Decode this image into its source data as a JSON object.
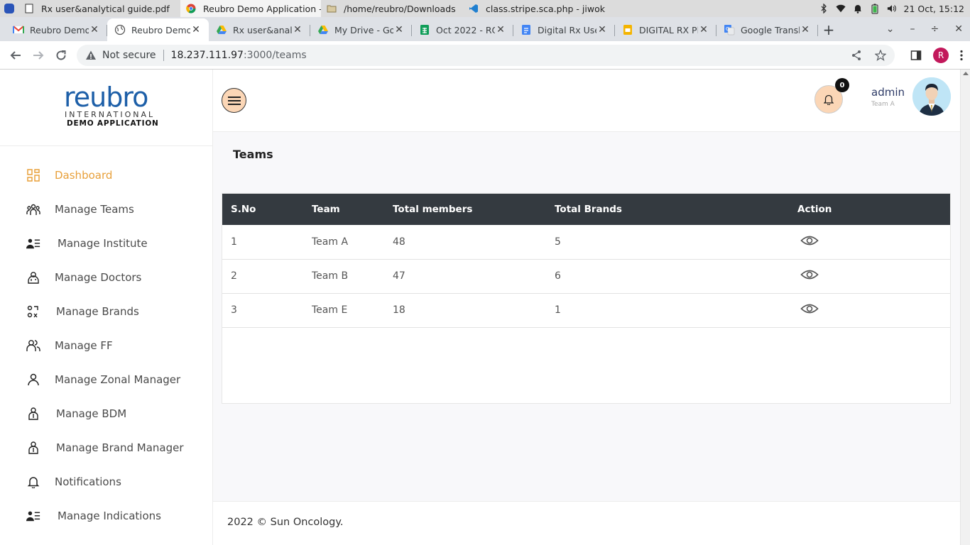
{
  "os": {
    "tasks": [
      {
        "label": "Rx user&analytical guide.pdf",
        "icon": "document-icon",
        "active": false
      },
      {
        "label": "Reubro Demo Application - ...",
        "icon": "chrome-icon",
        "active": true
      },
      {
        "label": "/home/reubro/Downloads",
        "icon": "folder-icon",
        "active": false
      },
      {
        "label": "class.stripe.sca.php - jiwok - ...",
        "icon": "vscode-icon",
        "active": false
      }
    ],
    "clock": "21 Oct, 15:12"
  },
  "browser": {
    "tabs": [
      {
        "label": "Reubro Demo",
        "icon": "gmail-icon",
        "active": false
      },
      {
        "label": "Reubro Demo",
        "icon": "globe-icon",
        "active": true
      },
      {
        "label": "Rx user&analy",
        "icon": "drive-icon",
        "active": false
      },
      {
        "label": "My Drive - Go",
        "icon": "drive-icon",
        "active": false
      },
      {
        "label": "Oct 2022 - RO",
        "icon": "sheets-icon",
        "active": false
      },
      {
        "label": "Digital Rx Use",
        "icon": "docs-icon",
        "active": false
      },
      {
        "label": "DIGITAL RX Pl",
        "icon": "slides-icon",
        "active": false
      },
      {
        "label": "Google Transl",
        "icon": "translate-icon",
        "active": false
      }
    ],
    "security_label": "Not secure",
    "url_host": "18.237.111.97",
    "url_path": ":3000/teams",
    "profile_initial": "R"
  },
  "sidebar": {
    "logo_main_1": "reu",
    "logo_main_2": "bro",
    "logo_sub": "INTERNATIONAL",
    "logo_demo": "DEMO APPLICATION",
    "items": [
      {
        "label": "Dashboard",
        "icon": "dashboard-icon"
      },
      {
        "label": "Manage Teams",
        "icon": "team-icon"
      },
      {
        "label": "Manage Institute",
        "icon": "institute-list-icon"
      },
      {
        "label": "Manage Doctors",
        "icon": "doctor-icon"
      },
      {
        "label": "Manage Brands",
        "icon": "brands-icon"
      },
      {
        "label": "Manage FF",
        "icon": "users-icon"
      },
      {
        "label": "Manage Zonal Manager",
        "icon": "person-icon"
      },
      {
        "label": "Manage BDM",
        "icon": "manager-icon"
      },
      {
        "label": "Manage Brand Manager",
        "icon": "manager-icon"
      },
      {
        "label": "Notifications",
        "icon": "bell-icon"
      },
      {
        "label": "Manage Indications",
        "icon": "institute-list-icon"
      }
    ]
  },
  "header": {
    "notification_count": "0",
    "user_name": "admin",
    "user_team": "Team A"
  },
  "page": {
    "title": "Teams",
    "table": {
      "columns": [
        "S.No",
        "Team",
        "Total members",
        "Total Brands",
        "Action"
      ],
      "rows": [
        {
          "sno": "1",
          "team": "Team A",
          "members": "48",
          "brands": "5"
        },
        {
          "sno": "2",
          "team": "Team B",
          "members": "47",
          "brands": "6"
        },
        {
          "sno": "3",
          "team": "Team E",
          "members": "18",
          "brands": "1"
        }
      ]
    }
  },
  "footer": {
    "text": "2022 © Sun Oncology."
  },
  "colors": {
    "accent": "#e8a03a",
    "button_bg": "#fbd6b6",
    "table_header": "#343a40",
    "logo_blue": "#1d5fa8"
  }
}
